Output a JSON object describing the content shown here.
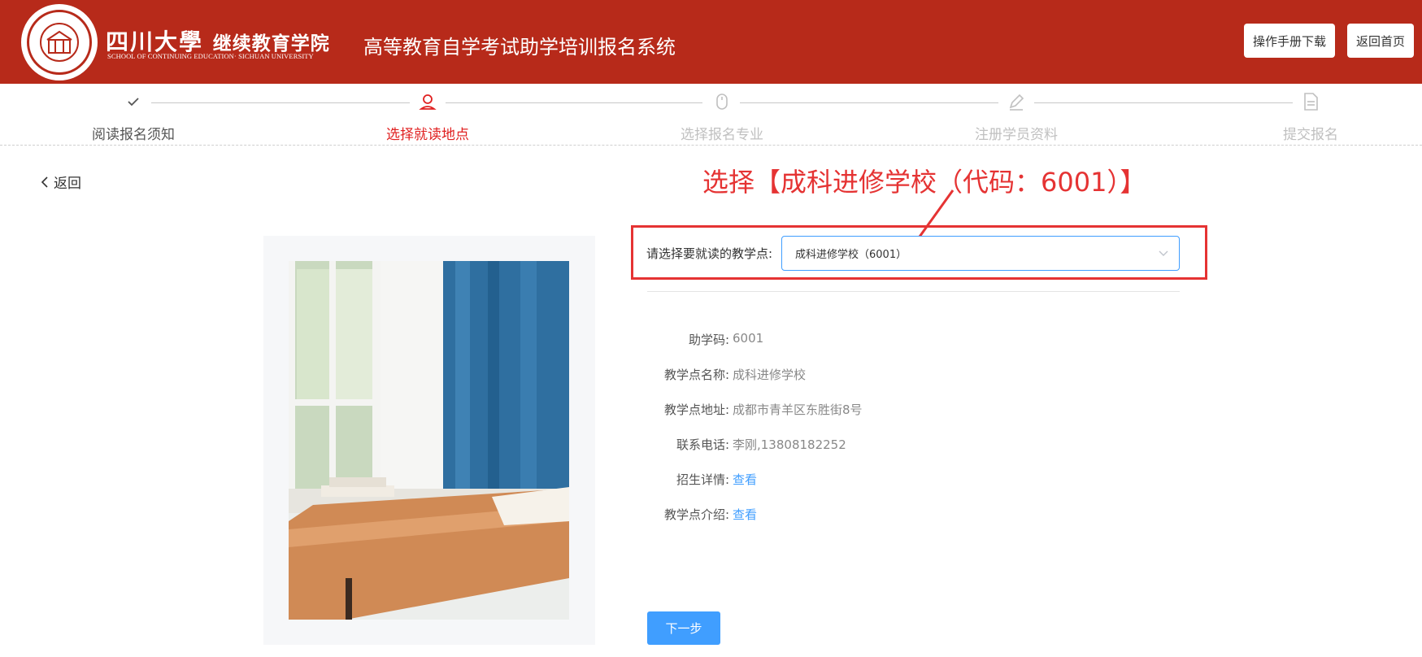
{
  "header": {
    "logo_text_main": "四川大學",
    "logo_text_sub": "继续教育学院",
    "logo_text_en": "SCHOOL OF CONTINUING EDUCATION· SICHUAN UNIVERSITY",
    "system_title": "高等教育自学考试助学培训报名系统",
    "manual_download_label": "操作手册下载",
    "home_label": "返回首页",
    "brand_color": "#b72a1a"
  },
  "steps": [
    {
      "label": "阅读报名须知",
      "state": "done",
      "icon": "check-icon"
    },
    {
      "label": "选择就读地点",
      "state": "active",
      "icon": "user-icon"
    },
    {
      "label": "选择报名专业",
      "state": "pending",
      "icon": "mouse-icon"
    },
    {
      "label": "注册学员资料",
      "state": "pending",
      "icon": "pen-icon"
    },
    {
      "label": "提交报名",
      "state": "pending",
      "icon": "document-icon"
    }
  ],
  "back_label": "返回",
  "annotation": "选择【成科进修学校（代码：6001）】",
  "select": {
    "label": "请选择要就读的教学点:",
    "value": "成科进修学校（6001）"
  },
  "info": [
    {
      "key": "助学码:",
      "value": "6001",
      "link": false
    },
    {
      "key": "教学点名称:",
      "value": "成科进修学校",
      "link": false
    },
    {
      "key": "教学点地址:",
      "value": "成都市青羊区东胜街8号",
      "link": false
    },
    {
      "key": "联系电话:",
      "value": "李刚,13808182252",
      "link": false
    },
    {
      "key": "招生详情:",
      "value": "查看",
      "link": true
    },
    {
      "key": "教学点介绍:",
      "value": "查看",
      "link": true
    }
  ],
  "next_label": "下一步",
  "colors": {
    "accent": "#409eff",
    "active_step": "#e02020",
    "annotation": "#e53333"
  }
}
